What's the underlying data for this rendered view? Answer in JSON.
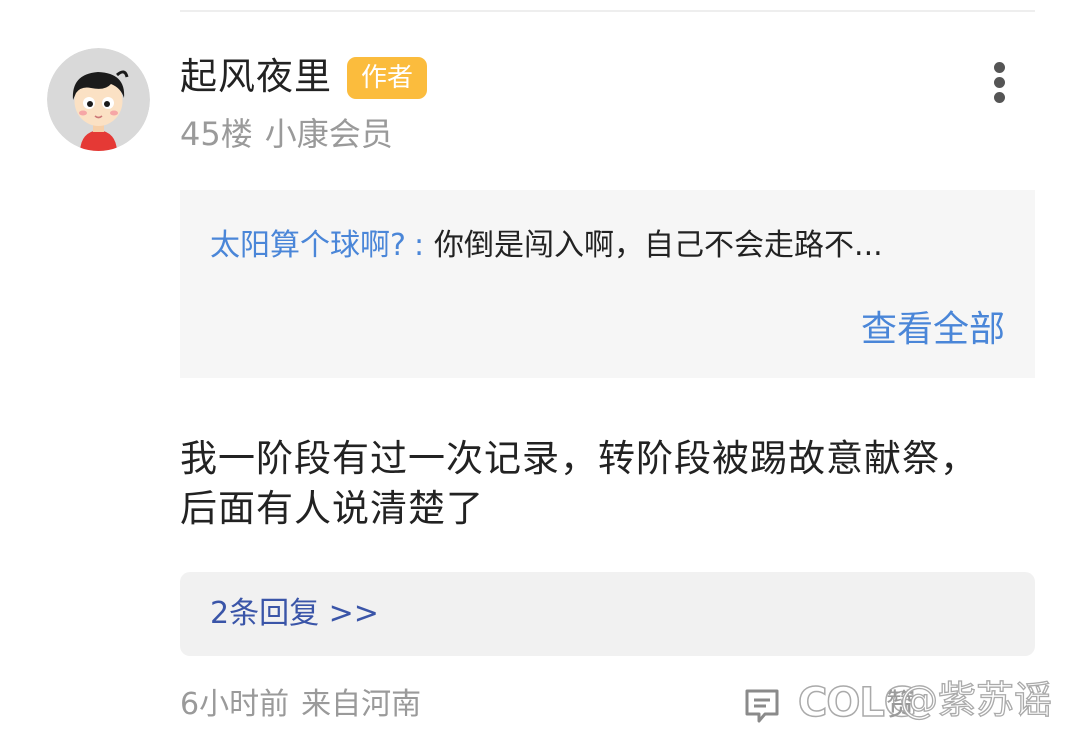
{
  "post": {
    "author": {
      "name": "起风夜里",
      "badge": "作者",
      "floor": "45楼",
      "membership": "小康会员"
    },
    "quote": {
      "author": "太阳算个球啊?",
      "colon": ":",
      "text": "你倒是闯入啊，自己不会走路不...",
      "view_all_label": "查看全部"
    },
    "content_lines": [
      "我一阶段有过一次记录，转阶段被踢故意献祭，",
      "后面有人说清楚了"
    ],
    "replies_label": "2条回复 >>",
    "time": "6小时前",
    "location": "来自河南",
    "like_label": "赞"
  },
  "watermark": {
    "logo": "COLG",
    "handle": "@紫苏谣"
  },
  "icons": {
    "more": "more-vertical-icon",
    "comment": "comment-icon",
    "like": "thumbs-up-icon",
    "avatar": "cartoon-avatar-icon"
  },
  "colors": {
    "link_blue": "#4a86d8",
    "reply_link": "#3a55a8",
    "badge_bg": "#fbbc3d",
    "meta_gray": "#9a9a9a",
    "quote_bg": "#f6f6f6",
    "replies_bg": "#f1f1f1"
  }
}
